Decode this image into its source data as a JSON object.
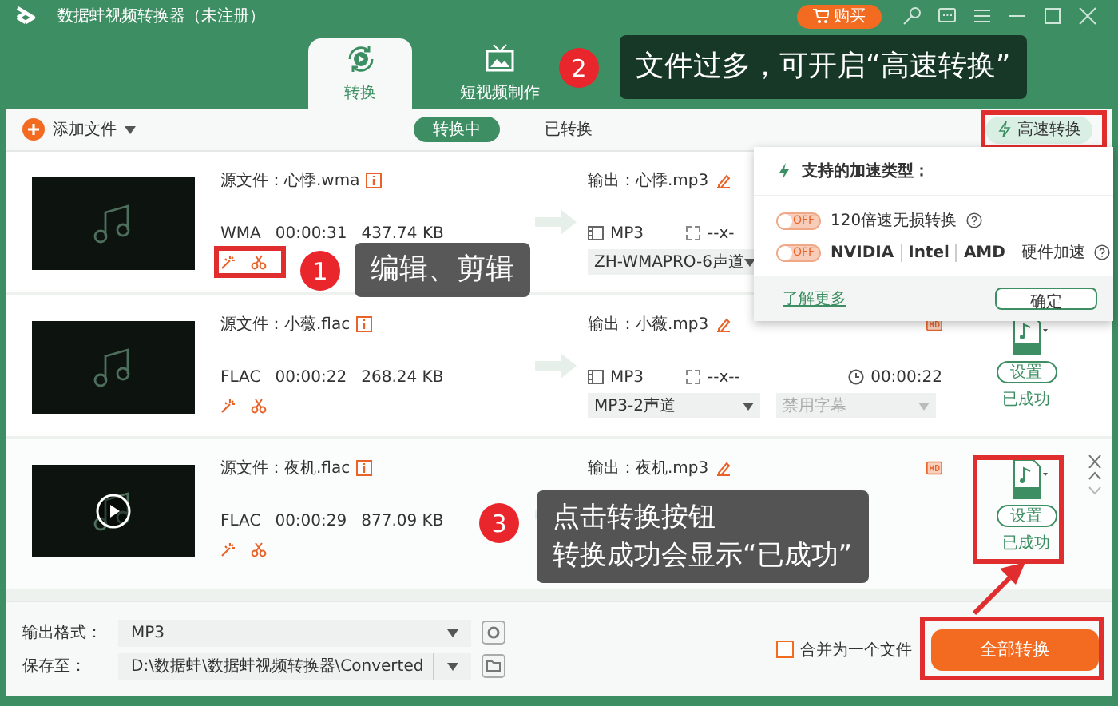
{
  "window": {
    "title": "数据蛙视频转换器（未注册）",
    "buy_button": "购买"
  },
  "tabs": [
    {
      "label": "转换",
      "selected": true,
      "kind": "convert"
    },
    {
      "label": "短视频制作",
      "selected": false,
      "kind": "video"
    }
  ],
  "toolbar": {
    "add_button": "添加文件",
    "queue_tabs": [
      {
        "label": "转换中",
        "selected": true
      },
      {
        "label": "已转换",
        "selected": false
      }
    ],
    "speed_button": "高速转换"
  },
  "files": [
    {
      "source": "源文件：心悸.wma",
      "format": "WMA",
      "duration": "00:00:31",
      "size": "437.74 KB",
      "output": "输出：心悸.mp3",
      "output_format": "MP3",
      "resolution": "--x-",
      "audio": "ZH-WMAPRO-6声道",
      "hovered": false
    },
    {
      "source": "源文件：小薇.flac",
      "format": "FLAC",
      "duration": "00:00:22",
      "size": "268.24 KB",
      "output": "输出：小薇.mp3",
      "output_format": "MP3",
      "resolution": "--x--",
      "audio": "MP3-2声道",
      "subtitle": "禁用字幕",
      "output_duration": "00:00:22",
      "settings_button": "设置",
      "status": "已成功",
      "hovered": false
    },
    {
      "source": "源文件：夜机.flac",
      "format": "FLAC",
      "duration": "00:00:29",
      "size": "877.09 KB",
      "output": "输出：夜机.mp3",
      "settings_button": "设置",
      "status": "已成功",
      "hovered": true
    }
  ],
  "speed_popup": {
    "title": "支持的加速类型：",
    "options": [
      {
        "kind": "text",
        "label": "120倍速无损转换",
        "switch_text": "OFF",
        "on": false
      },
      {
        "kind": "brands",
        "brands": [
          "NVIDIA",
          "Intel",
          "AMD"
        ],
        "label": "硬件加速",
        "switch_text": "OFF",
        "on": false
      }
    ],
    "link": "了解更多",
    "confirm_button": "确定"
  },
  "bottom": {
    "format_label": "输出格式：",
    "format_value": "MP3",
    "save_label": "保存至：",
    "save_path": "D:\\数据蛙\\数据蛙视频转换器\\Converted",
    "merge_label": "合并为一个文件",
    "merge_checked": false,
    "convert_all_button": "全部转换"
  },
  "annotations": [
    {
      "number": "1",
      "lines": [
        "编辑、剪辑"
      ]
    },
    {
      "number": "2",
      "lines": [
        "文件过多，可开启“高速转换”"
      ]
    },
    {
      "number": "3",
      "lines": [
        "点击转换按钮",
        "转换成功会显示“已成功”"
      ]
    }
  ]
}
